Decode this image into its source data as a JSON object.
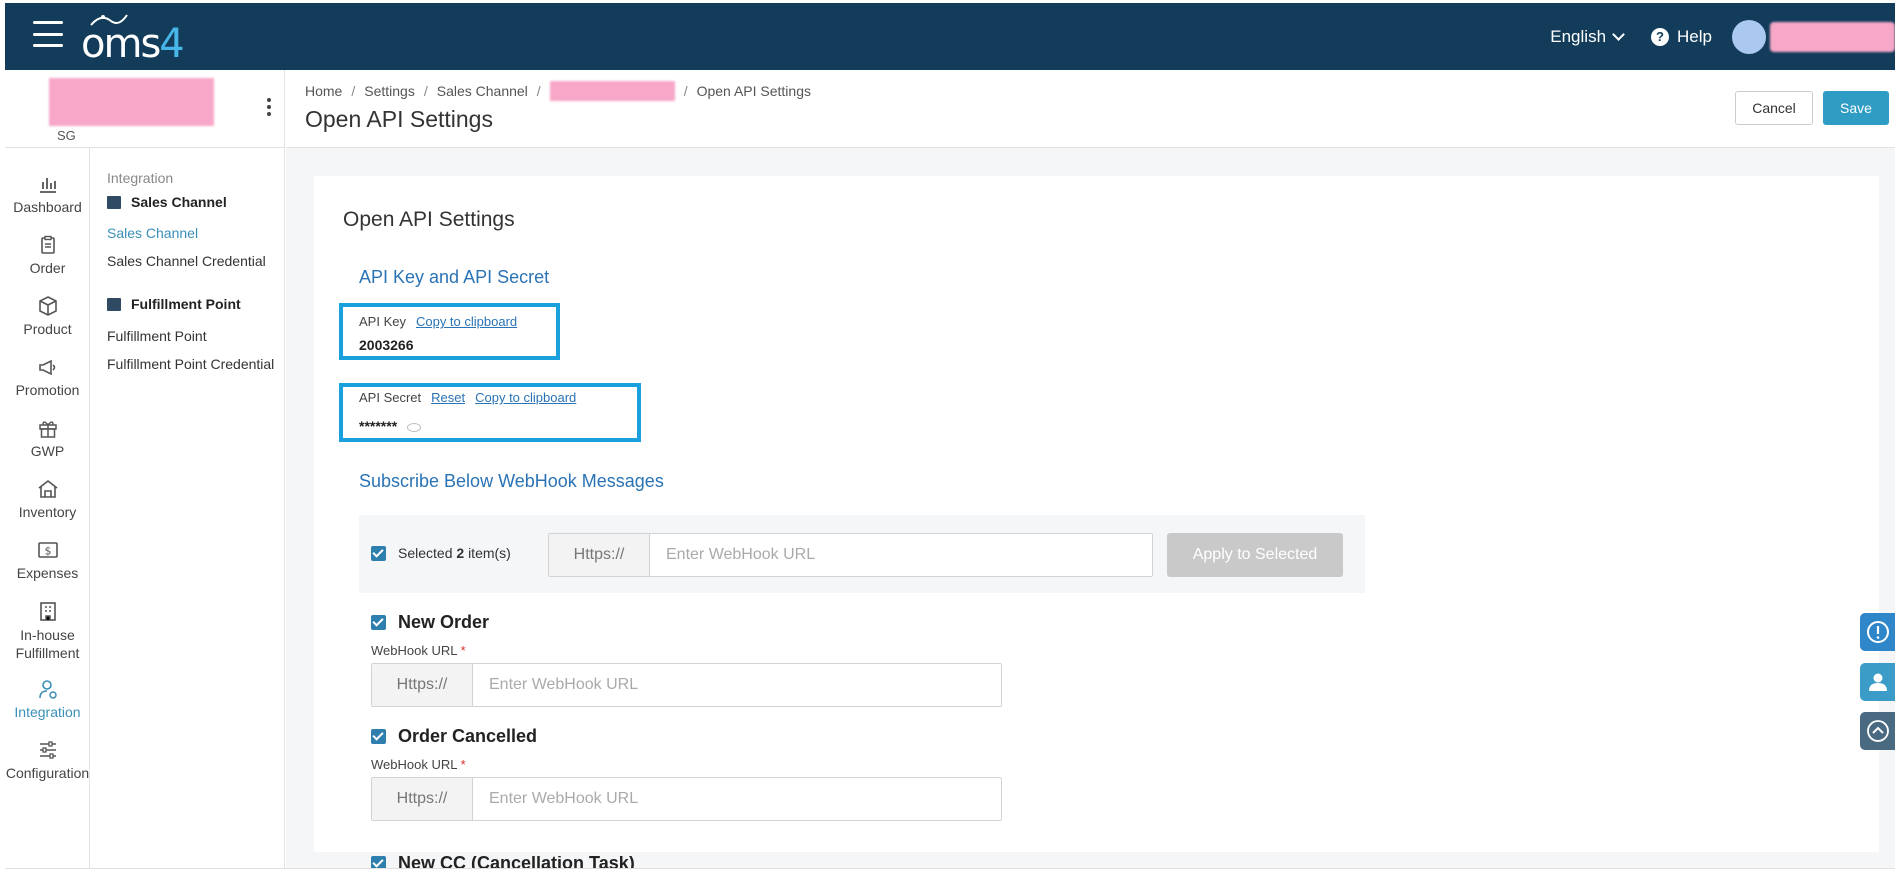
{
  "app": {
    "logo_text": "oms",
    "logo_num": "4",
    "language": "English",
    "help": "Help"
  },
  "store": {
    "code": "SG"
  },
  "nav": [
    {
      "label": "Dashboard",
      "icon": "chart-bar-icon"
    },
    {
      "label": "Order",
      "icon": "clipboard-icon"
    },
    {
      "label": "Product",
      "icon": "box-icon"
    },
    {
      "label": "Promotion",
      "icon": "megaphone-icon"
    },
    {
      "label": "GWP",
      "icon": "gift-icon"
    },
    {
      "label": "Inventory",
      "icon": "warehouse-icon"
    },
    {
      "label": "Expenses",
      "icon": "dollar-icon"
    },
    {
      "label": "In-house Fulfillment",
      "line1": "In-house",
      "line2": "Fulfillment",
      "icon": "building-icon"
    },
    {
      "label": "Integration",
      "icon": "user-gear-icon",
      "active": true
    },
    {
      "label": "Configuration",
      "icon": "sliders-icon"
    }
  ],
  "submenu": {
    "heading": "Integration",
    "group1": "Sales Channel",
    "group1_items": [
      "Sales Channel",
      "Sales Channel Credential"
    ],
    "group2": "Fulfillment Point",
    "group2_items": [
      "Fulfillment Point",
      "Fulfillment Point Credential"
    ]
  },
  "breadcrumb": [
    "Home",
    "Settings",
    "Sales Channel",
    "Open API Settings"
  ],
  "page": {
    "title": "Open API Settings",
    "cancel": "Cancel",
    "save": "Save",
    "card_title": "Open API Settings"
  },
  "api": {
    "section_title": "API Key and API Secret",
    "key_label": "API Key",
    "copy": "Copy to clipboard",
    "key_value": "2003266",
    "secret_label": "API Secret",
    "reset": "Reset",
    "secret_value": "*******"
  },
  "webhooks": {
    "section_title": "Subscribe Below WebHook Messages",
    "selected_prefix": "Selected",
    "selected_count": "2",
    "selected_suffix": "item(s)",
    "prefix": "Https://",
    "placeholder": "Enter WebHook URL",
    "apply": "Apply to Selected",
    "url_label": "WebHook URL",
    "required": "*",
    "items": [
      "New Order",
      "Order Cancelled"
    ],
    "cutoff_item": "New CC (Cancellation Task)"
  },
  "colors": {
    "topbar": "#123c5a",
    "accent": "#2f9cc4",
    "link": "#2a73b5",
    "highlight": "#1aa0dc"
  }
}
